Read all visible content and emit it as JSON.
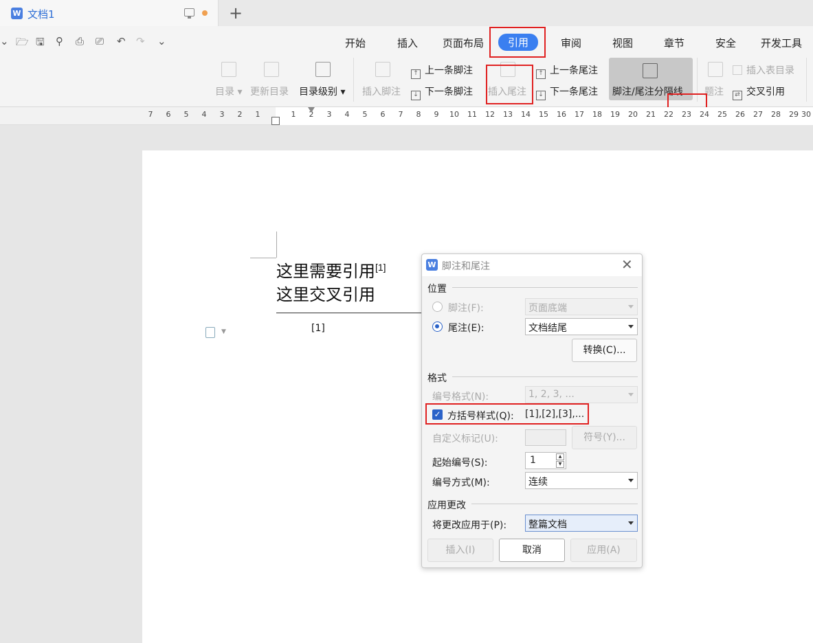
{
  "tab": {
    "title": "文档1",
    "new_tab": "+"
  },
  "menu": {
    "start": "开始",
    "insert": "插入",
    "layout": "页面布局",
    "reference": "引用",
    "review": "审阅",
    "view": "视图",
    "chapter": "章节",
    "security": "安全",
    "dev": "开发工具"
  },
  "ribbon": {
    "toc": "目录",
    "update_toc": "更新目录",
    "toc_level": "目录级别",
    "insert_footnote": "插入脚注",
    "prev_footnote": "上一条脚注",
    "next_footnote": "下一条脚注",
    "insert_endnote": "插入尾注",
    "prev_endnote": "上一条尾注",
    "next_endnote": "下一条尾注",
    "separator": "脚注/尾注分隔线",
    "caption": "题注",
    "insert_table_of_figures": "插入表目录",
    "cross_ref": "交叉引用"
  },
  "ruler": [
    "7",
    "6",
    "5",
    "4",
    "3",
    "2",
    "1",
    "1",
    "2",
    "3",
    "4",
    "5",
    "6",
    "7",
    "8",
    "9",
    "10",
    "11",
    "12",
    "13",
    "14",
    "15",
    "16",
    "17",
    "18",
    "19",
    "20",
    "21",
    "22",
    "23",
    "24",
    "25",
    "26",
    "27",
    "28",
    "29",
    "30"
  ],
  "doc": {
    "line1": "这里需要引用",
    "line1_sup": "[1]",
    "line2": "这里交叉引用",
    "footnote": "[1]"
  },
  "dialog": {
    "title": "脚注和尾注",
    "position": "位置",
    "footnote_label": "脚注(F):",
    "footnote_value": "页面底端",
    "endnote_label": "尾注(E):",
    "endnote_value": "文档结尾",
    "convert": "转换(C)...",
    "format": "格式",
    "number_format_label": "编号格式(N):",
    "number_format_value": "1, 2, 3, ...",
    "bracket_label": "方括号样式(Q):",
    "bracket_value": "[1],[2],[3],...",
    "custom_mark_label": "自定义标记(U):",
    "symbol": "符号(Y)...",
    "start_label": "起始编号(S):",
    "start_value": "1",
    "numbering_label": "编号方式(M):",
    "numbering_value": "连续",
    "apply": "应用更改",
    "apply_to_label": "将更改应用于(P):",
    "apply_to_value": "整篇文档",
    "insert_btn": "插入(I)",
    "cancel_btn": "取消",
    "apply_btn": "应用(A)"
  }
}
